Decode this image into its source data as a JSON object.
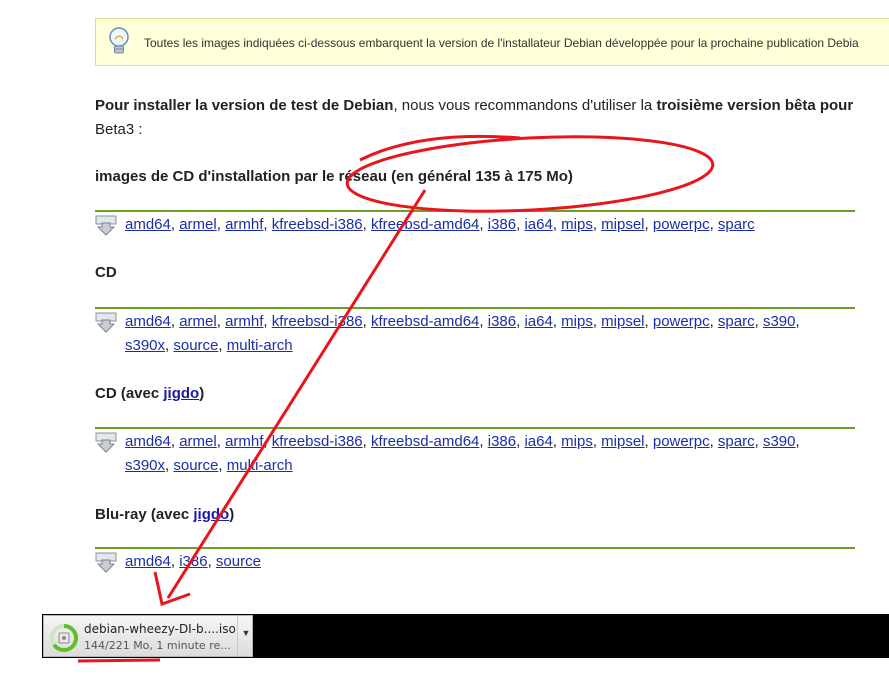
{
  "notice": {
    "icon": "lightbulb-icon",
    "text": "Toutes les images indiquées ci-dessous embarquent la version de l'installateur Debian développée pour la prochaine publication Debia"
  },
  "intro": {
    "bold1": "Pour installer la version de test de Debian",
    "text1": ", nous vous recommandons d'utiliser la ",
    "bold2": "troisième version bêta pour",
    "line2": "Beta3 :"
  },
  "sections": [
    {
      "title": "images de CD d'installation par le réseau (en général 135 à 175 Mo)",
      "links": [
        "amd64",
        "armel",
        "armhf",
        "kfreebsd-i386",
        "kfreebsd-amd64",
        "i386",
        "ia64",
        "mips",
        "mipsel",
        "powerpc",
        "sparc"
      ]
    },
    {
      "title": "CD",
      "links": [
        "amd64",
        "armel",
        "armhf",
        "kfreebsd-i386",
        "kfreebsd-amd64",
        "i386",
        "ia64",
        "mips",
        "mipsel",
        "powerpc",
        "sparc",
        "s390",
        "s390x",
        "source",
        "multi-arch"
      ]
    },
    {
      "title": "CD (avec ",
      "title_link": "jigdo",
      "title_end": ")",
      "links": [
        "amd64",
        "armel",
        "armhf",
        "kfreebsd-i386",
        "kfreebsd-amd64",
        "i386",
        "ia64",
        "mips",
        "mipsel",
        "powerpc",
        "sparc",
        "s390",
        "s390x",
        "source",
        "multi-arch"
      ]
    },
    {
      "title": "Blu-ray (avec ",
      "title_link": "jigdo",
      "title_end": ")",
      "links": [
        "amd64",
        "i386",
        "source"
      ]
    }
  ],
  "download": {
    "filename": "debian-wheezy-DI-b....iso",
    "status": "144/221 Mo, 1 minute re...",
    "progress": 0.65,
    "icon": "disc-file-icon",
    "menu_icon": "chevron-down-icon"
  },
  "colors": {
    "link": "#1b2ea8",
    "rule": "#6aa121",
    "annotation": "#e8161c",
    "notice_bg": "#ffffd9"
  }
}
